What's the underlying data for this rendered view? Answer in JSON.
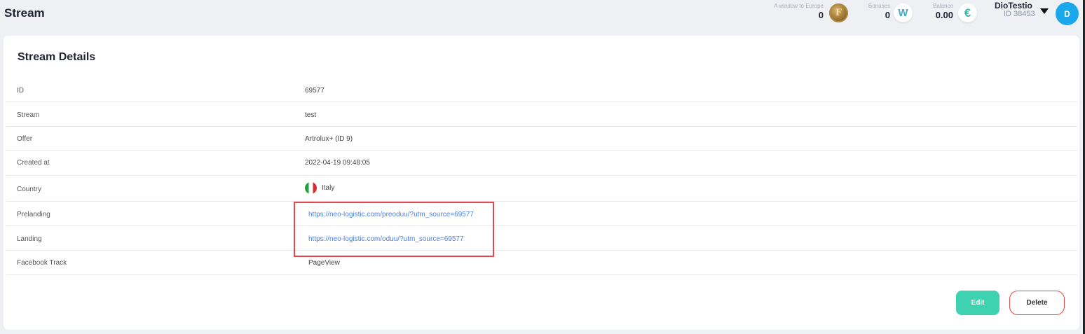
{
  "header": {
    "title": "Stream",
    "stats": [
      {
        "label": "A window to Europe",
        "value": "0",
        "icon": "coin-icon"
      },
      {
        "label": "Bonuses",
        "value": "0",
        "icon": "w-icon"
      },
      {
        "label": "Balance",
        "value": "0.00",
        "icon": "euro-icon"
      }
    ],
    "coin_glyph": "F",
    "w_glyph": "W",
    "euro_glyph": "€",
    "user": {
      "name": "DioTestio",
      "id": "ID 38453",
      "avatar_letter": "D"
    }
  },
  "details": {
    "title": "Stream Details",
    "rows": [
      {
        "label": "ID",
        "value": "69577"
      },
      {
        "label": "Stream",
        "value": "test"
      },
      {
        "label": "Offer",
        "value": "Artrolux+ (ID 9)"
      },
      {
        "label": "Created at",
        "value": "2022-04-19 09:48:05"
      },
      {
        "label": "Country",
        "value": "Italy"
      },
      {
        "label": "Prelanding",
        "value": "https://neo-logistic.com/preoduu/?utm_source=69577"
      },
      {
        "label": "Landing",
        "value": "https://neo-logistic.com/oduu/?utm_source=69577"
      },
      {
        "label": "Facebook Track",
        "value": "PageView"
      }
    ]
  },
  "actions": {
    "edit_label": "Edit",
    "delete_label": "Delete"
  },
  "colors": {
    "accent": "#3ed2b0",
    "link": "#4b82e6",
    "danger": "#e0484e",
    "avatar": "#1aa7ec"
  }
}
